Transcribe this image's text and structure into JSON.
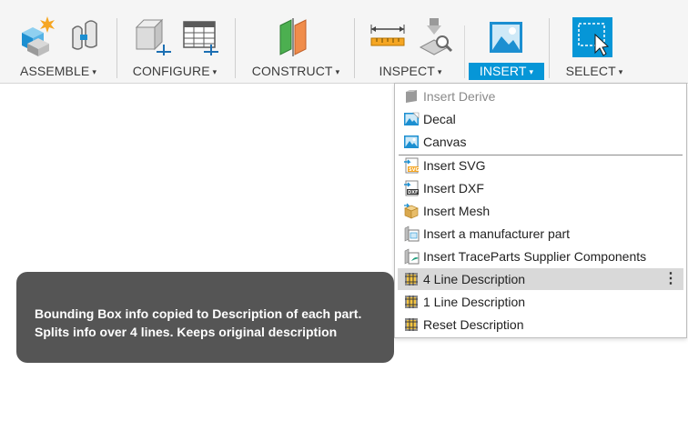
{
  "toolbar": {
    "groups": [
      {
        "label": "ASSEMBLE",
        "icons": [
          "assemble-new-component-icon",
          "joint-icon"
        ]
      },
      {
        "label": "CONFIGURE",
        "icons": [
          "configure-parameter-icon",
          "configure-table-icon"
        ]
      },
      {
        "label": "CONSTRUCT",
        "icons": [
          "construct-plane-icon"
        ]
      },
      {
        "label": "INSPECT",
        "icons": [
          "measure-ruler-icon",
          "inspect-interference-icon"
        ]
      },
      {
        "label": "INSERT",
        "icons": [
          "insert-image-icon"
        ],
        "active": true
      },
      {
        "label": "SELECT",
        "icons": [
          "select-window-icon"
        ]
      }
    ],
    "caret": "▾"
  },
  "menu": {
    "items": [
      {
        "label": "Insert Derive",
        "icon": "insert-derive-icon",
        "disabled": true
      },
      {
        "label": "Decal",
        "icon": "decal-icon"
      },
      {
        "label": "Canvas",
        "icon": "canvas-icon"
      },
      {
        "label": "Insert SVG",
        "icon": "insert-svg-icon"
      },
      {
        "label": "Insert DXF",
        "icon": "insert-dxf-icon"
      },
      {
        "label": "Insert Mesh",
        "icon": "insert-mesh-icon"
      },
      {
        "label": "Insert a manufacturer part",
        "icon": "manufacturer-part-icon"
      },
      {
        "label": "Insert TraceParts Supplier Components",
        "icon": "traceparts-icon"
      },
      {
        "label": "4 Line Description",
        "icon": "script-addin-icon",
        "highlighted": true,
        "more": "⋮"
      },
      {
        "label": "1 Line Description",
        "icon": "script-addin-icon"
      },
      {
        "label": "Reset Description",
        "icon": "script-addin-icon"
      }
    ]
  },
  "tooltip": {
    "text": "Bounding Box info copied to Description of each part. Splits info over 4 lines. Keeps original description"
  },
  "colors": {
    "accent": "#0696d7",
    "tooltip_bg": "#555555",
    "toolbar_bg": "#f5f5f5"
  }
}
